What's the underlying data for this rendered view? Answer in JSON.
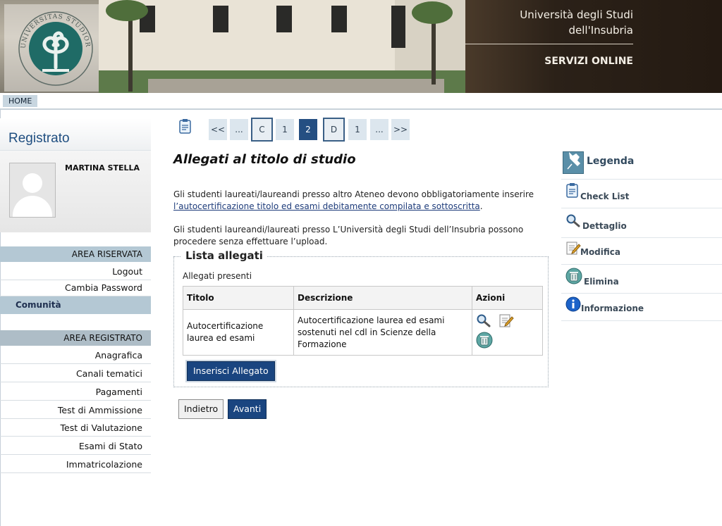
{
  "header": {
    "university_line1": "Università degli Studi",
    "university_line2": "dell'Insubria",
    "services": "SERVIZI ONLINE",
    "logo_text": "UNIVERSITAS STUDIORUM INSUBRIAE"
  },
  "nav": {
    "home": "HOME"
  },
  "sidebar": {
    "title": "Registrato",
    "user_name": "MARTINA STELLA",
    "area_riservata": "AREA RISERVATA",
    "riservata_items": [
      {
        "label": "Logout"
      },
      {
        "label": "Cambia Password"
      }
    ],
    "comunita": "Comunità",
    "area_registrato": "AREA REGISTRATO",
    "registrato_items": [
      {
        "label": "Anagrafica"
      },
      {
        "label": "Canali tematici"
      },
      {
        "label": "Pagamenti"
      },
      {
        "label": "Test di Ammissione"
      },
      {
        "label": "Test di Valutazione"
      },
      {
        "label": "Esami di Stato"
      },
      {
        "label": "Immatricolazione"
      }
    ]
  },
  "pager": {
    "items": [
      "<<",
      "...",
      "C",
      "1",
      "2",
      "D",
      "1",
      "...",
      ">>"
    ]
  },
  "main": {
    "title": "Allegati al titolo di studio",
    "para1_text": "Gli studenti laureati/laureandi presso altro Ateneo devono obbligatoriamente inserire",
    "para1_link": "l’autocertificazione titolo ed esami debitamente compilata e sottoscritta",
    "para1_end": ".",
    "para2": "Gli studenti laureandi/laureati presso L’Università degli Studi dell’Insubria possono procedere senza effettuare l’upload.",
    "fieldset_legend": "Lista allegati",
    "presenti": "Allegati presenti",
    "table": {
      "headers": [
        "Titolo",
        "Descrizione",
        "Azioni"
      ],
      "rows": [
        {
          "titolo": "Autocertificazione laurea ed esami",
          "descrizione": "Autocertificazione laurea ed esami sostenuti nel cdl in Scienze della Formazione"
        }
      ]
    },
    "insert_button": "Inserisci Allegato",
    "back_button": "Indietro",
    "next_button": "Avanti"
  },
  "legend": {
    "title": "Legenda",
    "items": [
      {
        "label": "Check List",
        "icon": "clipboard-icon"
      },
      {
        "label": "Dettaglio",
        "icon": "magnifier-icon"
      },
      {
        "label": "Modifica",
        "icon": "edit-icon"
      },
      {
        "label": "Elimina",
        "icon": "trash-icon"
      },
      {
        "label": "Informazione",
        "icon": "info-icon"
      }
    ]
  }
}
